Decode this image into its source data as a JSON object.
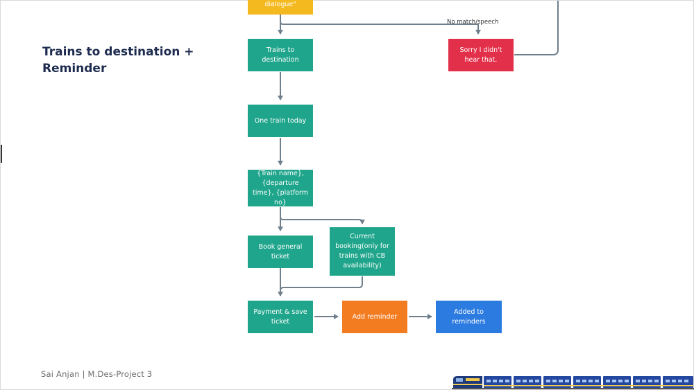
{
  "slide": {
    "title": "Trains to destination + Reminder",
    "footer": "Sai Anjan | M.Des-Project 3"
  },
  "flow": {
    "nodes": {
      "dialogue": "dialogue\"",
      "trains_to_destination": "Trains to destination",
      "sorry": "Sorry I didn't hear that.",
      "one_train_today": "One train today",
      "train_details": "{Train name}, {departure time}, {platform no}",
      "book_general_ticket": "Book general ticket",
      "current_booking": "Current booking(only for trains with CB availability)",
      "payment_save_ticket": "Payment & save ticket",
      "add_reminder": "Add reminder",
      "added_to_reminders": "Added to reminders"
    },
    "edge_labels": {
      "no_match": "No match/speech"
    }
  },
  "colors": {
    "teal": "#1fa58b",
    "red": "#e3304a",
    "orange": "#f37c21",
    "blue": "#2c7be0",
    "yellow": "#f4b91e",
    "connector": "#6f7f8c",
    "title": "#1d2b4f"
  },
  "decoration": {
    "train_icon": "train-illustration"
  }
}
